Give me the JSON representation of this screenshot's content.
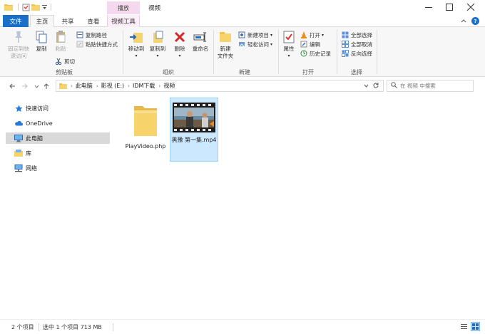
{
  "window": {
    "contextual_tab": "播放",
    "title": "视频",
    "controls": {
      "minimize": "—",
      "maximize": "☐",
      "close": "✕"
    }
  },
  "tabs": {
    "file": "文件",
    "home": "主页",
    "share": "共享",
    "view": "查看",
    "video_tools": "视频工具",
    "help": "?"
  },
  "ribbon": {
    "clipboard": {
      "label": "剪贴板",
      "pin": "固定到快\n速访问",
      "copy": "复制",
      "paste": "粘贴",
      "copy_path": "复制路径",
      "paste_shortcut": "粘贴快捷方式",
      "cut": "剪切"
    },
    "organize": {
      "label": "组织",
      "move_to": "移动到",
      "copy_to": "复制到",
      "delete": "删除",
      "rename": "重命名"
    },
    "new": {
      "label": "新建",
      "new_folder": "新建\n文件夹",
      "new_item": "新建项目",
      "easy_access": "轻松访问"
    },
    "open": {
      "label": "打开",
      "properties": "属性",
      "open": "打开",
      "edit": "编辑",
      "history": "历史记录"
    },
    "select": {
      "label": "选择",
      "select_all": "全部选择",
      "select_none": "全部取消",
      "invert": "反向选择"
    }
  },
  "address": {
    "breadcrumbs": [
      "此电脑",
      "影视 (E:)",
      "IDM下载",
      "视频"
    ],
    "search_placeholder": "在 视频 中搜索"
  },
  "navpane": {
    "items": [
      {
        "label": "快速访问",
        "icon": "star-icon"
      },
      {
        "label": "OneDrive",
        "icon": "cloud-icon"
      },
      {
        "label": "此电脑",
        "icon": "computer-icon"
      },
      {
        "label": "库",
        "icon": "library-icon"
      },
      {
        "label": "网络",
        "icon": "network-icon"
      }
    ]
  },
  "files": [
    {
      "name": "PlayVideo.php",
      "type": "folder"
    },
    {
      "name": "黑豫 第一集.mp4",
      "type": "video"
    }
  ],
  "status": {
    "count": "2 个项目",
    "selected": "选中 1 个项目  713 MB"
  },
  "colors": {
    "accent": "#1a6fc7",
    "context_tab": "#f4d9ee",
    "selection": "#cce8ff",
    "folder": "#f6d36b"
  }
}
